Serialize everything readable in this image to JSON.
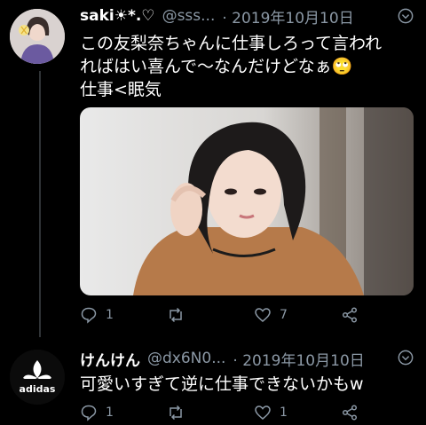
{
  "tweet1": {
    "display_name": "saki☀*.♡",
    "handle": "@sss...",
    "date": "· 2019年10月10日",
    "text_line1": "この友梨奈ちゃんに仕事しろって言われ",
    "text_line2": "ればはい喜んで〜なんだけどなぁ🙄",
    "text_line3": "仕事<眠気",
    "reply_count": "1",
    "retweet_count": "",
    "like_count": "7"
  },
  "tweet2": {
    "display_name": "けんけん",
    "handle": "@dx6N0...",
    "date": "· 2019年10月10日",
    "text": "可愛いすぎて逆に仕事できないかもw",
    "avatar_label": "adidas",
    "reply_count": "1",
    "retweet_count": "",
    "like_count": "1"
  },
  "colors": {
    "background": "#000000",
    "secondary_text": "#8b98a5",
    "thread_line": "#2f3336"
  },
  "icons": [
    "reply-icon",
    "retweet-icon",
    "like-icon",
    "share-icon",
    "chevron-down-icon"
  ]
}
